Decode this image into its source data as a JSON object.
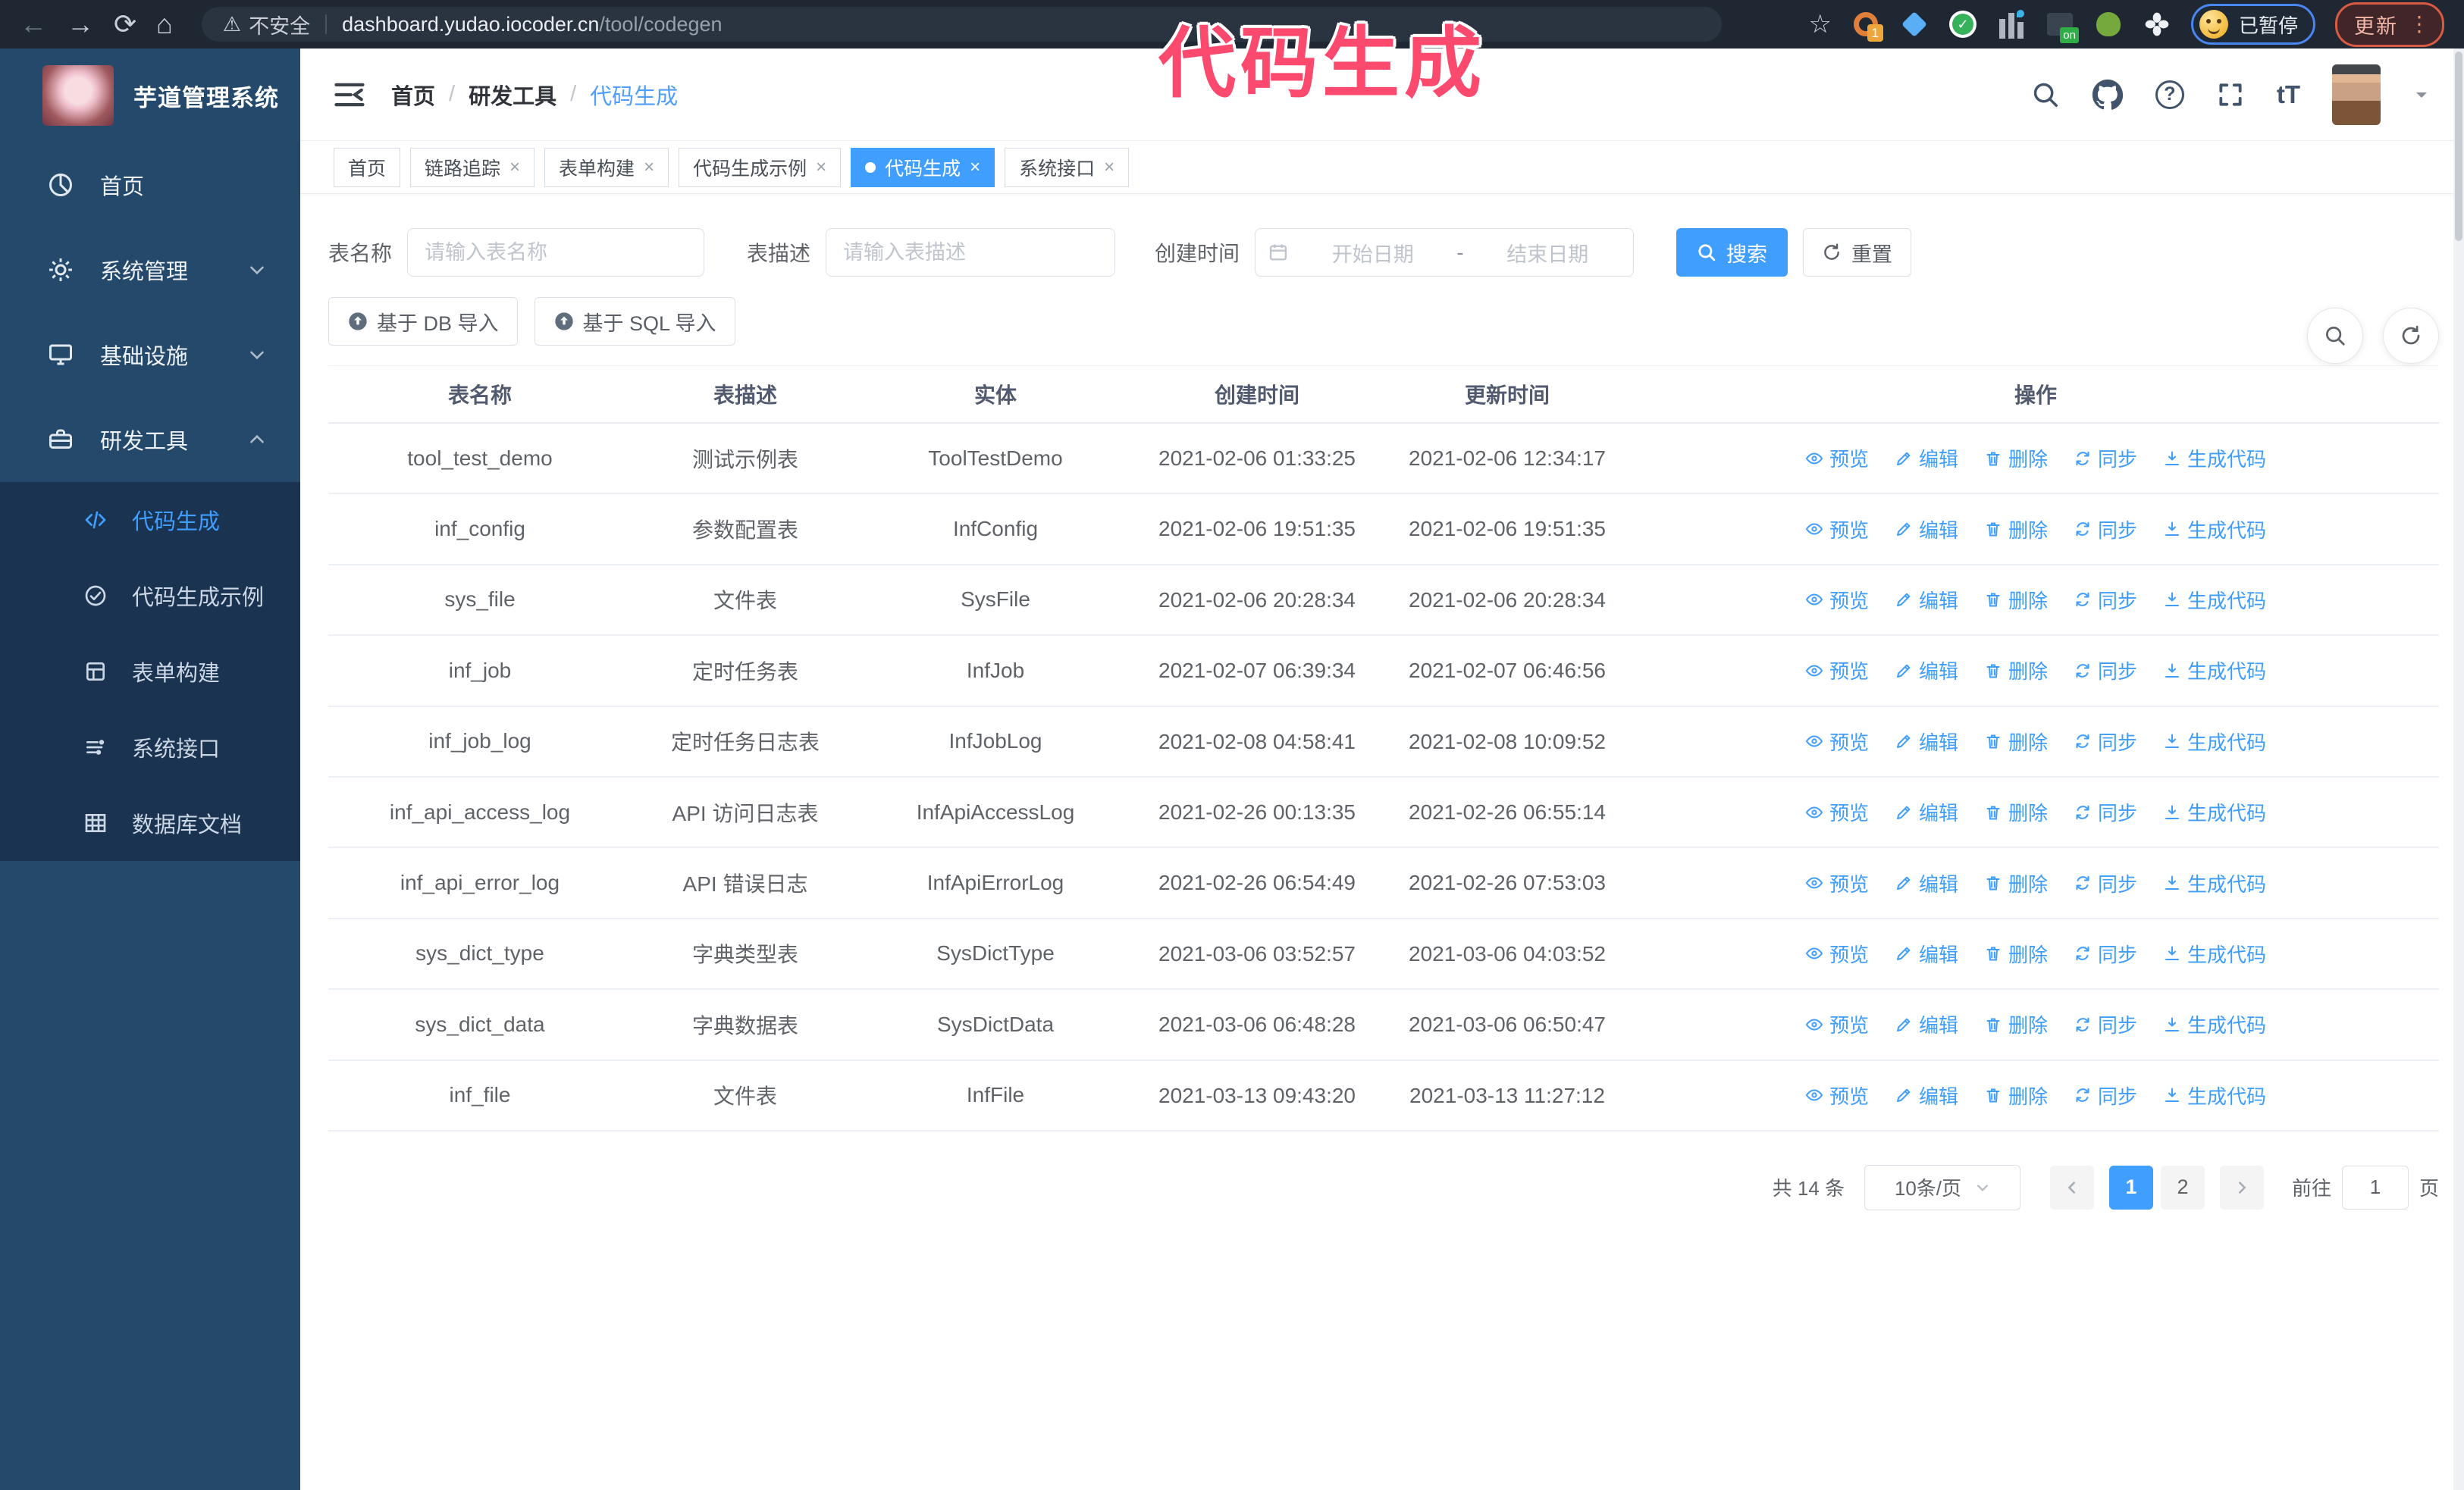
{
  "browser": {
    "security_label": "不安全",
    "url_host": "dashboard.yudao.iocoder.cn",
    "url_path": "/tool/codegen",
    "extension_badge": "1",
    "extension_on_badge": "on",
    "paused_badge": "已暂停",
    "update_button": "更新"
  },
  "annotation": {
    "text": "代码生成",
    "color": "#fb4a6e"
  },
  "sidebar": {
    "app_title": "芋道管理系统",
    "items": [
      {
        "id": "home",
        "label": "首页",
        "icon": "dashboard-icon",
        "expandable": false,
        "expanded": false
      },
      {
        "id": "system",
        "label": "系统管理",
        "icon": "gear-icon",
        "expandable": true,
        "expanded": false
      },
      {
        "id": "infra",
        "label": "基础设施",
        "icon": "infra-icon",
        "expandable": true,
        "expanded": false
      },
      {
        "id": "devtools",
        "label": "研发工具",
        "icon": "tools-icon",
        "expandable": true,
        "expanded": true
      }
    ],
    "submenu": [
      {
        "id": "codegen",
        "label": "代码生成",
        "icon": "code-icon",
        "active": true
      },
      {
        "id": "codegen-example",
        "label": "代码生成示例",
        "icon": "example-icon",
        "active": false
      },
      {
        "id": "form-builder",
        "label": "表单构建",
        "icon": "form-icon",
        "active": false
      },
      {
        "id": "system-api",
        "label": "系统接口",
        "icon": "api-icon",
        "active": false
      },
      {
        "id": "db-doc",
        "label": "数据库文档",
        "icon": "db-doc-icon",
        "active": false
      }
    ]
  },
  "header": {
    "breadcrumb": [
      "首页",
      "研发工具",
      "代码生成"
    ],
    "tabs": [
      {
        "label": "首页",
        "closable": false,
        "active": false
      },
      {
        "label": "链路追踪",
        "closable": true,
        "active": false
      },
      {
        "label": "表单构建",
        "closable": true,
        "active": false
      },
      {
        "label": "代码生成示例",
        "closable": true,
        "active": false
      },
      {
        "label": "代码生成",
        "closable": true,
        "active": true
      },
      {
        "label": "系统接口",
        "closable": true,
        "active": false
      }
    ]
  },
  "filters": {
    "table_name": {
      "label": "表名称",
      "placeholder": "请输入表名称",
      "value": ""
    },
    "table_desc": {
      "label": "表描述",
      "placeholder": "请输入表描述",
      "value": ""
    },
    "create_time": {
      "label": "创建时间",
      "start_placeholder": "开始日期",
      "separator": "-",
      "end_placeholder": "结束日期"
    },
    "search_label": "搜索",
    "reset_label": "重置"
  },
  "toolbar": {
    "import_db_label": "基于 DB 导入",
    "import_sql_label": "基于 SQL 导入"
  },
  "table": {
    "columns": [
      "表名称",
      "表描述",
      "实体",
      "创建时间",
      "更新时间",
      "操作"
    ],
    "actions": [
      {
        "id": "preview",
        "label": "预览",
        "icon": "eye-icon"
      },
      {
        "id": "edit",
        "label": "编辑",
        "icon": "edit-icon"
      },
      {
        "id": "delete",
        "label": "删除",
        "icon": "delete-icon"
      },
      {
        "id": "sync",
        "label": "同步",
        "icon": "sync-icon"
      },
      {
        "id": "generate",
        "label": "生成代码",
        "icon": "generate-icon"
      }
    ],
    "rows": [
      {
        "name": "tool_test_demo",
        "desc": "测试示例表",
        "entity": "ToolTestDemo",
        "created": "2021-02-06 01:33:25",
        "updated": "2021-02-06 12:34:17",
        "created_wrap": false,
        "updated_wrap": false
      },
      {
        "name": "inf_config",
        "desc": "参数配置表",
        "entity": "InfConfig",
        "created": "2021-02-06 19:51:35",
        "updated": "2021-02-06 19:51:35",
        "created_wrap": false,
        "updated_wrap": false
      },
      {
        "name": "sys_file",
        "desc": "文件表",
        "entity": "SysFile",
        "created": "2021-02-06 20:28:34",
        "updated": "2021-02-06 20:28:34",
        "created_wrap": true,
        "updated_wrap": true
      },
      {
        "name": "inf_job",
        "desc": "定时任务表",
        "entity": "InfJob",
        "created": "2021-02-07 06:39:34",
        "updated": "2021-02-07 06:46:56",
        "created_wrap": true,
        "updated_wrap": true
      },
      {
        "name": "inf_job_log",
        "desc": "定时任务日志表",
        "entity": "InfJobLog",
        "created": "2021-02-08 04:58:41",
        "updated": "2021-02-08 10:09:52",
        "created_wrap": true,
        "updated_wrap": true
      },
      {
        "name": "inf_api_access_log",
        "desc": "API 访问日志表",
        "entity": "InfApiAccessLog",
        "created": "2021-02-26 00:13:35",
        "updated": "2021-02-26 06:55:14",
        "created_wrap": false,
        "updated_wrap": true
      },
      {
        "name": "inf_api_error_log",
        "desc": "API 错误日志",
        "entity": "InfApiErrorLog",
        "created": "2021-02-26 06:54:49",
        "updated": "2021-02-26 07:53:03",
        "created_wrap": true,
        "updated_wrap": true
      },
      {
        "name": "sys_dict_type",
        "desc": "字典类型表",
        "entity": "SysDictType",
        "created": "2021-03-06 03:52:57",
        "updated": "2021-03-06 04:03:52",
        "created_wrap": true,
        "updated_wrap": true
      },
      {
        "name": "sys_dict_data",
        "desc": "字典数据表",
        "entity": "SysDictData",
        "created": "2021-03-06 06:48:28",
        "updated": "2021-03-06 06:50:47",
        "created_wrap": true,
        "updated_wrap": true
      },
      {
        "name": "inf_file",
        "desc": "文件表",
        "entity": "InfFile",
        "created": "2021-03-13 09:43:20",
        "updated": "2021-03-13 11:27:12",
        "created_wrap": true,
        "updated_wrap": false
      }
    ]
  },
  "pagination": {
    "total_label": "共 14 条",
    "page_size": "10条/页",
    "pages": [
      "1",
      "2"
    ],
    "active_page": "1",
    "goto_label": "前往",
    "goto_value": "1",
    "goto_suffix": "页"
  }
}
